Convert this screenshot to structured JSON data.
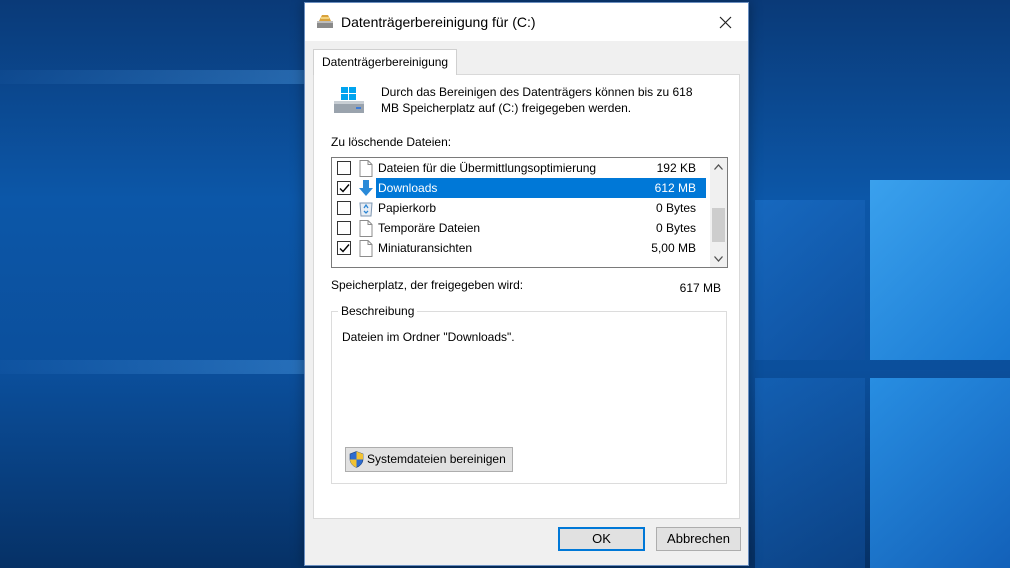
{
  "window": {
    "title": "Datenträgerbereinigung für  (C:)"
  },
  "tab": {
    "label": "Datenträgerbereinigung"
  },
  "intro": {
    "text": "Durch das Bereinigen des Datenträgers können bis zu 618 MB Speicherplatz auf  (C:) freigegeben werden."
  },
  "files": {
    "label": "Zu löschende Dateien:",
    "items": [
      {
        "name": "Dateien für die Übermittlungsoptimierung",
        "size": "192 KB",
        "checked": false,
        "icon": "file-icon"
      },
      {
        "name": "Downloads",
        "size": "612 MB",
        "checked": true,
        "icon": "download-arrow-icon",
        "selected": true
      },
      {
        "name": "Papierkorb",
        "size": "0 Bytes",
        "checked": false,
        "icon": "recycle-bin-icon"
      },
      {
        "name": "Temporäre Dateien",
        "size": "0 Bytes",
        "checked": false,
        "icon": "file-icon"
      },
      {
        "name": "Miniaturansichten",
        "size": "5,00 MB",
        "checked": true,
        "icon": "file-icon"
      }
    ]
  },
  "space": {
    "label": "Speicherplatz, der freigegeben wird:",
    "value": "617 MB"
  },
  "description": {
    "legend": "Beschreibung",
    "text": "Dateien im Ordner \"Downloads\".",
    "button_label": "Systemdateien bereinigen"
  },
  "buttons": {
    "ok": "OK",
    "cancel": "Abbrechen"
  },
  "colors": {
    "selection": "#0078d7",
    "dialog_bg": "#f0f0f0"
  }
}
